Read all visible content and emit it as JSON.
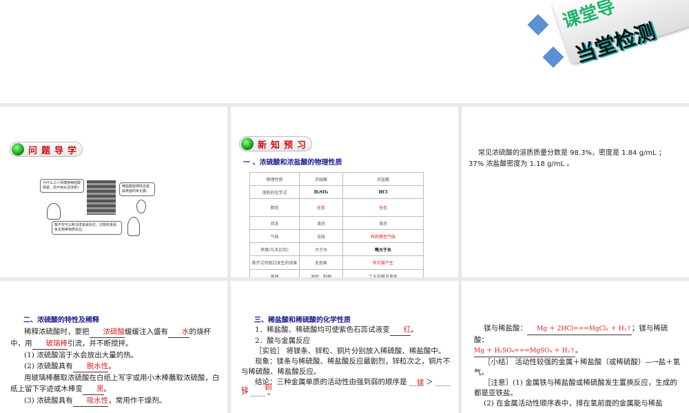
{
  "slide_top": {
    "title_line1": "课堂导",
    "title_line2": "当堂检测"
  },
  "slide1": {
    "badge": "问题导学",
    "bubble1": "为什么工人师傅用稀盐酸除锈，而不用水清洗呢？",
    "bubble2": "稀盐酸能够除去金属表面的氧化膜。",
    "bubble3": "酸不仅可以和活泼金属反应，还能和金属氧化物等物质反应。"
  },
  "slide2": {
    "badge": "新知预习",
    "heading": "一 、浓硫酸和浓盐酸的物理性质",
    "table": [
      [
        "物理性质",
        "浓硫酸",
        "浓盐酸"
      ],
      [
        "溶质的化学式",
        "H₂SO₄",
        "HCl"
      ],
      [
        "颜色",
        "无色",
        "无色"
      ],
      [
        "状态",
        "液态",
        "液态"
      ],
      [
        "气味",
        "无味",
        "有刺激性气味"
      ],
      [
        "密度(与水比较)",
        "大于水",
        "略大于水"
      ],
      [
        "敞开试剂瓶口发生的现象",
        "无现象",
        "有白雾产生"
      ],
      [
        "其他",
        "油状、黏稠",
        "工业盐酸呈黄色"
      ]
    ]
  },
  "slide3": {
    "text": "常见浓硫酸的溶质质量分数是 98.3%，密度是 1.84 g/mL ；37% 浓盐酸密度为 1.18 g/mL 。"
  },
  "slide4": {
    "heading": "二、浓硫酸的特性及稀释",
    "l1a": "稀释浓硫酸时，要把",
    "b1": "浓硫酸",
    "l1b": "缓缓注入盛有",
    "b2": "水",
    "l1c": "的烧杯中，用",
    "b3": "玻璃棒",
    "l1d": "引流，并不断搅拌。",
    "l2": "(1) 浓硫酸溶于水会放出大量的热。",
    "l3": "(2) 浓硫酸具有",
    "b4": "脱水性",
    "l4": "用玻璃棒蘸取浓硫酸在白纸上写字或用小木棒蘸取浓硫酸，白纸上留下字迹或木棒变",
    "b5": "黑",
    "l5": "(3) 浓硫酸具有",
    "b6": "吸水性",
    "l5b": "，常用作干燥剂。"
  },
  "slide5": {
    "heading": "三、稀盐酸和稀硫酸的化学性质",
    "l1": "1．稀盐酸、稀硫酸均可使紫色石蕊试液变",
    "b1": "红",
    "l2": "2．酸与金属反应",
    "l3": "［实验］ 将镁条、锌粒、铜片分别放入稀硫酸、稀盐酸中。",
    "l4": "现象：镁条与稀硫酸、稀盐酸反应最剧烈，锌粒次之，铜片不与稀硫酸、稀盐酸反应。",
    "l5": "结论：三种金属单质的活动性由强到弱的顺序是",
    "a1": "镁",
    "a2": "锌",
    "a3": "铜"
  },
  "slide6": {
    "l1a": "镁与稀盐酸：",
    "eq1": "Mg ＋ 2HCl===MgCl₂ ＋ H₂↑",
    "l1b": "；镁与稀硫酸：",
    "eq2": "Mg ＋ H₂SO₄===MgSO₄ ＋ H₂↑",
    "l2": "［小结］ 活动性较强的金属＋稀盐酸（或稀硫酸）—→盐＋氢气。",
    "l3": "［注意］(1) 金属铁与稀盐酸或稀硫酸发生置换反应，生成的都是亚铁盐。",
    "l4": "(2) 在金属活动性顺序表中，排在氢前面的金属能与稀盐"
  }
}
